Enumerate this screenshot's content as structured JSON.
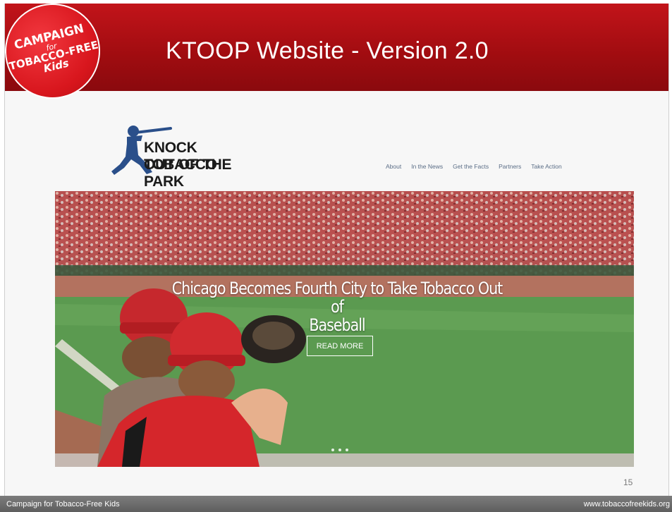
{
  "slide": {
    "title": "KTOOP Website - Version 2.0",
    "page_number": "15",
    "colors": {
      "header_red": "#a50d12",
      "footer_gray": "#6d6d6d"
    }
  },
  "org_logo": {
    "line1": "CAMPAIGN",
    "line2": "for",
    "line3": "TOBACCO-FREE",
    "line4": "Kids"
  },
  "website": {
    "logo_line1": "KNOCK TOBACCO",
    "logo_line2": "OUT OF THE PARK",
    "logo_icon": "baseball-batter-icon",
    "nav": [
      "About",
      "In the News",
      "Get the Facts",
      "Partners",
      "Take Action"
    ],
    "hero": {
      "headline_line1": "Chicago Becomes Fourth City to Take Tobacco Out of",
      "headline_line2": "Baseball",
      "button_label": "READ MORE",
      "carousel_dots": 3
    }
  },
  "footer": {
    "left": "Campaign for Tobacco-Free Kids",
    "right": "www.tobaccofreekids.org"
  }
}
